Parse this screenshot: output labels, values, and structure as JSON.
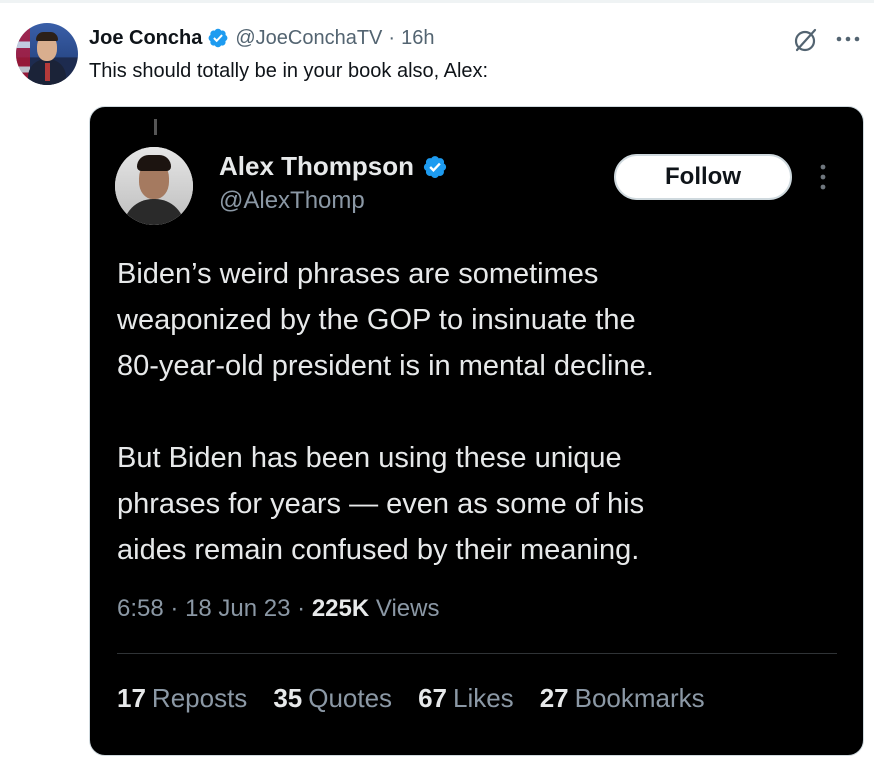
{
  "outer_tweet": {
    "author_name": "Joe Concha",
    "handle": "@JoeConchaTV",
    "separator": "·",
    "time": "16h",
    "text": "This should totally be in your book also, Alex:"
  },
  "embedded": {
    "author_name": "Alex Thompson",
    "handle": "@AlexThomp",
    "follow_label": "Follow",
    "body_paragraph_1": [
      "Biden’s weird phrases are sometimes",
      "weaponized by the GOP to insinuate the",
      "80-year-old president is in mental decline."
    ],
    "body_paragraph_2": [
      "But Biden has been using these unique",
      "phrases for years — even as some of his",
      "aides remain confused by their meaning."
    ],
    "time": "6:58",
    "date": "18 Jun 23",
    "views_count": "225K",
    "views_label": "Views",
    "separator": "·",
    "stats": {
      "reposts_count": "17",
      "reposts_label": "Reposts",
      "quotes_count": "35",
      "quotes_label": "Quotes",
      "likes_count": "67",
      "likes_label": "Likes",
      "bookmarks_count": "27",
      "bookmarks_label": "Bookmarks"
    }
  },
  "colors": {
    "verified_blue": "#1d9bf0",
    "dark_background": "#000000",
    "muted_text": "#536471"
  },
  "icons": [
    "verified-badge-icon",
    "grok-icon",
    "more-options-icon"
  ]
}
